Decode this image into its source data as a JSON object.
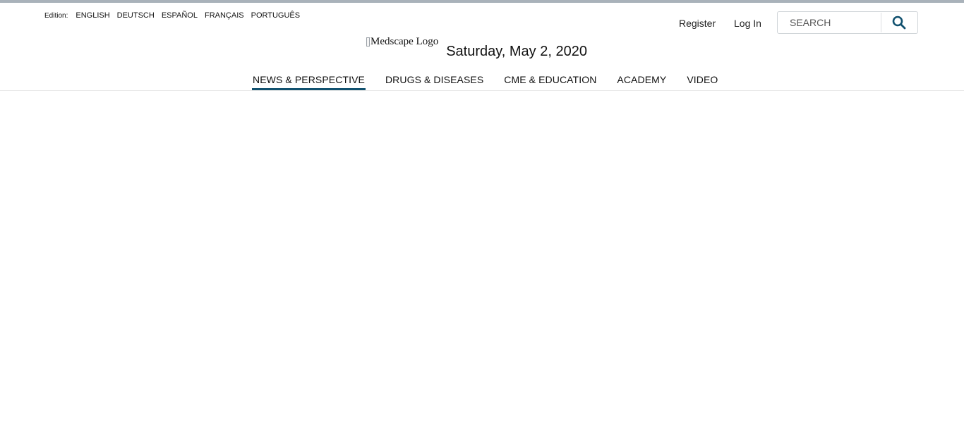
{
  "edition": {
    "label": "Edition:",
    "languages": [
      "ENGLISH",
      "DEUTSCH",
      "ESPAÑOL",
      "FRANÇAIS",
      "PORTUGUÊS"
    ]
  },
  "account": {
    "register": "Register",
    "login": "Log In"
  },
  "search": {
    "placeholder": "SEARCH",
    "icon": "magnifier",
    "icon_color": "#11516f"
  },
  "logo": {
    "alt_text": "Medscape Logo"
  },
  "date": "Saturday, May 2, 2020",
  "nav": {
    "tabs": [
      "NEWS & PERSPECTIVE",
      "DRUGS & DISEASES",
      "CME & EDUCATION",
      "ACADEMY",
      "VIDEO"
    ],
    "active_tab": "NEWS & PERSPECTIVE",
    "accent_color": "#11516f"
  },
  "colors": {
    "top_bar": "#a9b2ba",
    "background": "#ffffff"
  }
}
